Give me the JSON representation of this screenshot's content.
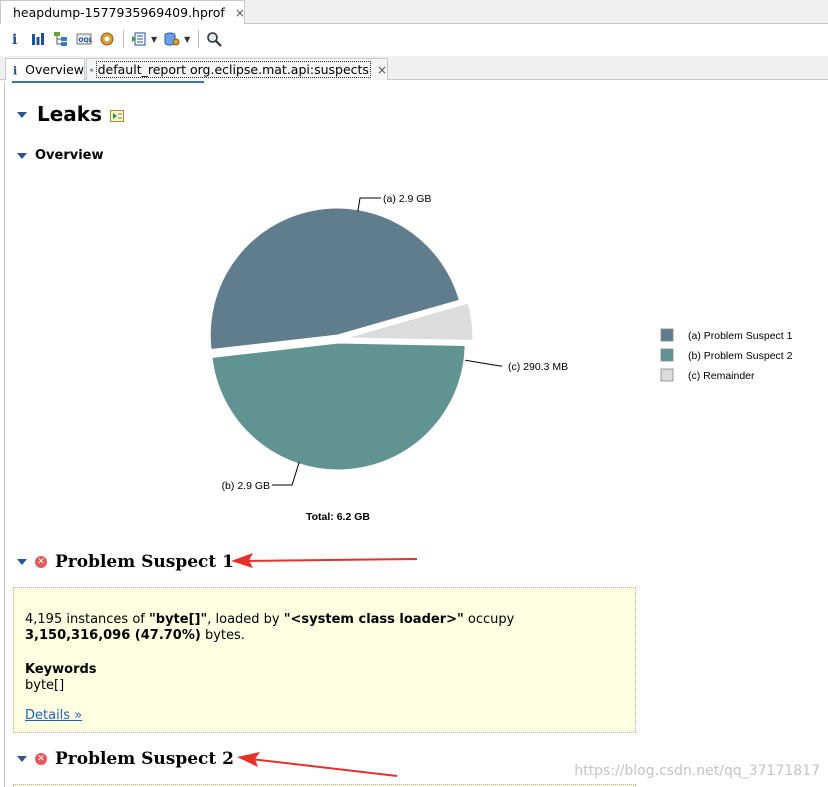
{
  "editor": {
    "file_tab_title": "heapdump-1577935969409.hprof",
    "close_glyph": "×"
  },
  "toolbar": {
    "icons": [
      "info-icon",
      "histogram-icon",
      "dominator-tree-icon",
      "oql-icon",
      "heap-dump-overview-icon",
      "run-expert-report-icon",
      "query-browser-icon",
      "search-icon"
    ],
    "dropdown_glyph": "▼"
  },
  "tabs": {
    "overview_label": "Overview",
    "report_label": "default_report  org.eclipse.mat.api:suspects"
  },
  "page": {
    "leaks_title": "Leaks",
    "overview_title": "Overview"
  },
  "chart_data": {
    "type": "pie",
    "slices": [
      {
        "id": "a",
        "label": "(a)  2.9 GB",
        "legend": "(a)  Problem Suspect 1",
        "value": 2.9,
        "color": "#5f7d8d"
      },
      {
        "id": "b",
        "label": "(b)  2.9 GB",
        "legend": "(b)  Problem Suspect 2",
        "value": 2.93,
        "color": "#629393"
      },
      {
        "id": "c",
        "label": "(c)  290.3 MB",
        "legend": "(c)  Remainder",
        "value": 0.2903,
        "color": "#dcdcdc"
      }
    ],
    "total_label": "Total: 6.2 GB",
    "legend_position": "right"
  },
  "suspects": [
    {
      "title": "Problem Suspect 1",
      "desc_count": "4,195 instances of ",
      "desc_class": "\"byte[]\"",
      "desc_loaded": ", loaded by ",
      "desc_loader": "\"<system class loader>\"",
      "desc_occupy": " occupy",
      "desc_bytes": "3,150,316,096 (47.70%)",
      "desc_bytes_suffix": " bytes.",
      "keywords_title": "Keywords",
      "keywords": "byte[]",
      "details_link": "Details »"
    },
    {
      "title": "Problem Suspect 2"
    }
  ],
  "watermark": "https://blog.csdn.net/qq_37171817",
  "colors": {
    "arrow": "#e8302a",
    "twisty": "#2a5590",
    "suspect_bg": "#ffffe1",
    "link": "#2060c0"
  }
}
